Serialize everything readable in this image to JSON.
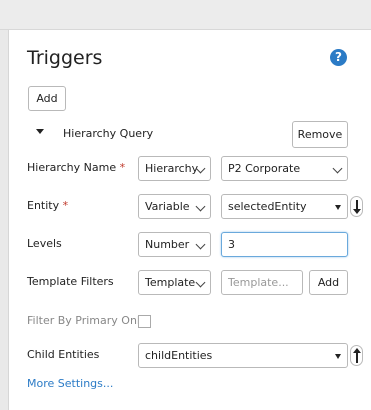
{
  "page": {
    "title": "Triggers",
    "add_label": "Add",
    "help_icon": "question-mark-icon"
  },
  "section": {
    "name": "Hierarchy Query",
    "remove_label": "Remove"
  },
  "fields": {
    "hierarchy_name": {
      "label": "Hierarchy Name",
      "required_marker": "*",
      "type_value": "Hierarchy",
      "value": "P2 Corporate"
    },
    "entity": {
      "label": "Entity",
      "required_marker": "*",
      "type_value": "Variable",
      "value": "selectedEntity"
    },
    "levels": {
      "label": "Levels",
      "type_value": "Number",
      "value": "3"
    },
    "template_filters": {
      "label": "Template Filters",
      "type_value": "Template",
      "placeholder": "Template...",
      "add_label": "Add"
    },
    "filter_by_primary_only": {
      "label": "Filter By Primary Only",
      "checked": false
    },
    "child_entities": {
      "label": "Child Entities",
      "value": "childEntities"
    }
  },
  "more_settings": "More Settings...",
  "colors": {
    "accent": "#2b7bc6",
    "required": "#c0392b",
    "focus_border": "#6aa9dc"
  }
}
